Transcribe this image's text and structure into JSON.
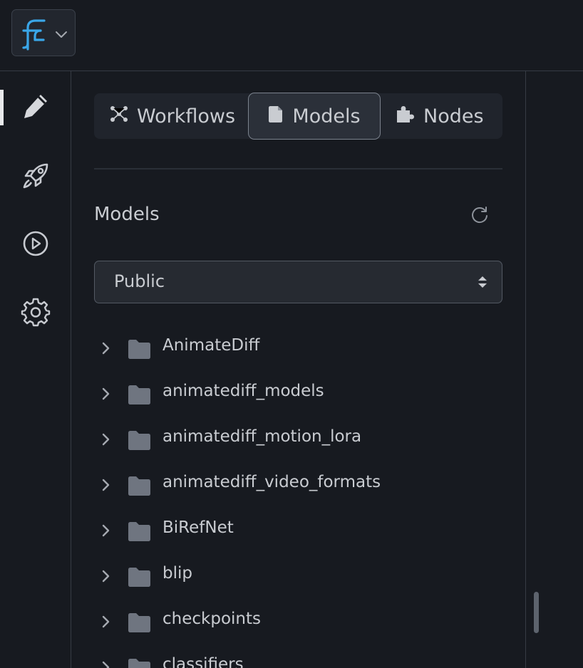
{
  "app": {
    "logo_icon": "flow-logo-icon",
    "accent": "#3aa6e8"
  },
  "rail": {
    "items": [
      {
        "name": "edit",
        "icon": "pencil-icon",
        "active": true
      },
      {
        "name": "deploy",
        "icon": "rocket-icon",
        "active": false
      },
      {
        "name": "run",
        "icon": "play-circle-icon",
        "active": false
      },
      {
        "name": "settings",
        "icon": "gear-icon",
        "active": false
      }
    ]
  },
  "tabs": {
    "workflows": "Workflows",
    "models": "Models",
    "nodes": "Nodes",
    "active": "Models"
  },
  "models_section": {
    "title": "Models",
    "visibility_select": "Public"
  },
  "tree": {
    "folders": [
      "AnimateDiff",
      "animatediff_models",
      "animatediff_motion_lora",
      "animatediff_video_formats",
      "BiRefNet",
      "blip",
      "checkpoints",
      "classifiers"
    ]
  }
}
